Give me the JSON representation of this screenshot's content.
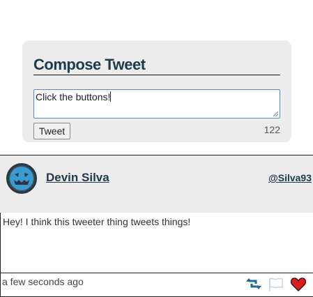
{
  "compose": {
    "title": "Compose Tweet",
    "text_value": "Click the buttons!",
    "tweet_button_label": "Tweet",
    "char_count": "122"
  },
  "tweet": {
    "user_name": "Devin Silva",
    "handle": "@Silva93",
    "text": "Hey! I think this tweeter thing tweets things!",
    "timestamp": "a few seconds ago",
    "icons": {
      "avatar": "pumpkin-face-avatar",
      "retweet": "retweet-icon",
      "flag": "flag-icon",
      "like": "heart-icon"
    }
  },
  "colors": {
    "panel_bg": "#ececec",
    "heading": "#1e3a4a",
    "focus_border": "#5a86d8",
    "retweet": "#1d6a9a",
    "like": "#d42020"
  }
}
